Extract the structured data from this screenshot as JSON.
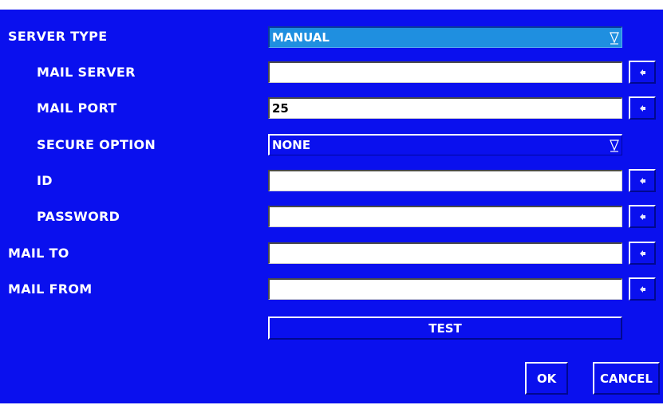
{
  "form": {
    "server_type": {
      "label": "SERVER TYPE",
      "value": "MANUAL"
    },
    "mail_server": {
      "label": "MAIL SERVER",
      "value": ""
    },
    "mail_port": {
      "label": "MAIL PORT",
      "value": "25"
    },
    "secure_option": {
      "label": "SECURE OPTION",
      "value": "NONE"
    },
    "id": {
      "label": "ID",
      "value": ""
    },
    "password": {
      "label": "PASSWORD",
      "value": ""
    },
    "mail_to": {
      "label": "MAIL TO",
      "value": ""
    },
    "mail_from": {
      "label": "MAIL FROM",
      "value": ""
    }
  },
  "buttons": {
    "test": "TEST",
    "ok": "OK",
    "cancel": "CANCEL"
  },
  "icons": {
    "dropdown": "chevron-down-icon",
    "virtual_keyboard": "keyboard-icon"
  },
  "colors": {
    "background": "#0a10ee",
    "selected_dropdown": "#1f8fe0",
    "text": "#ffffff",
    "input_bg": "#ffffff"
  }
}
